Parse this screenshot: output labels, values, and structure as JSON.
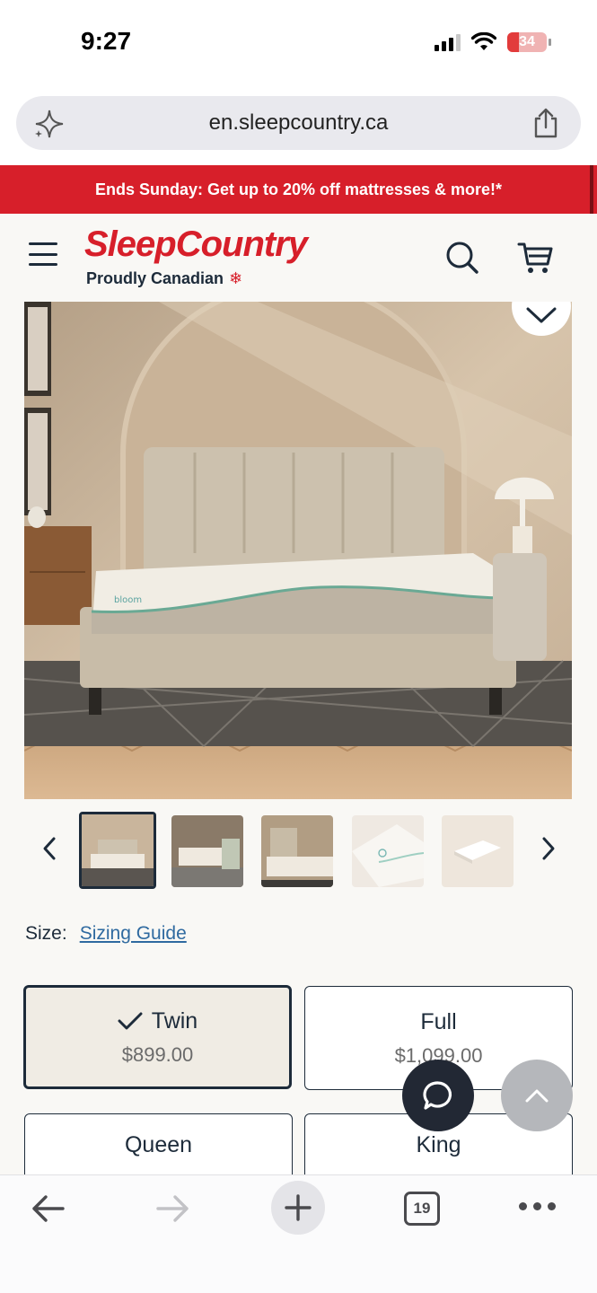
{
  "status_bar": {
    "time": "9:27",
    "battery": "34"
  },
  "browser": {
    "url": "en.sleepcountry.ca",
    "tab_count": "19"
  },
  "promo": {
    "text": "Ends Sunday: Get up to 20% off mattresses & more!*"
  },
  "header": {
    "logo": "SleepCountry",
    "tagline": "Proudly Canadian"
  },
  "product": {
    "image_brand_mark": "bloom",
    "thumbnail_count": 5,
    "selected_thumbnail": 1
  },
  "size": {
    "label": "Size:",
    "guide_link": "Sizing Guide",
    "options": [
      {
        "name": "Twin",
        "price": "$899.00",
        "selected": true
      },
      {
        "name": "Full",
        "price": "$1,099.00",
        "selected": false
      },
      {
        "name": "Queen",
        "price": "",
        "selected": false
      },
      {
        "name": "King",
        "price": "",
        "selected": false
      }
    ]
  },
  "colors": {
    "brand_red": "#d71f2a",
    "navy": "#1d2b3a",
    "link_blue": "#2f6aa0",
    "selected_bg": "#f0ece4"
  },
  "icons": {
    "url_left": "sparkle-icon",
    "url_right": "share-icon",
    "menu": "hamburger-menu-icon",
    "search": "search-icon",
    "cart": "cart-icon",
    "wishlist": "chevron-down-icon",
    "chat": "chat-bubble-icon",
    "scroll_top": "chevron-up-icon"
  }
}
